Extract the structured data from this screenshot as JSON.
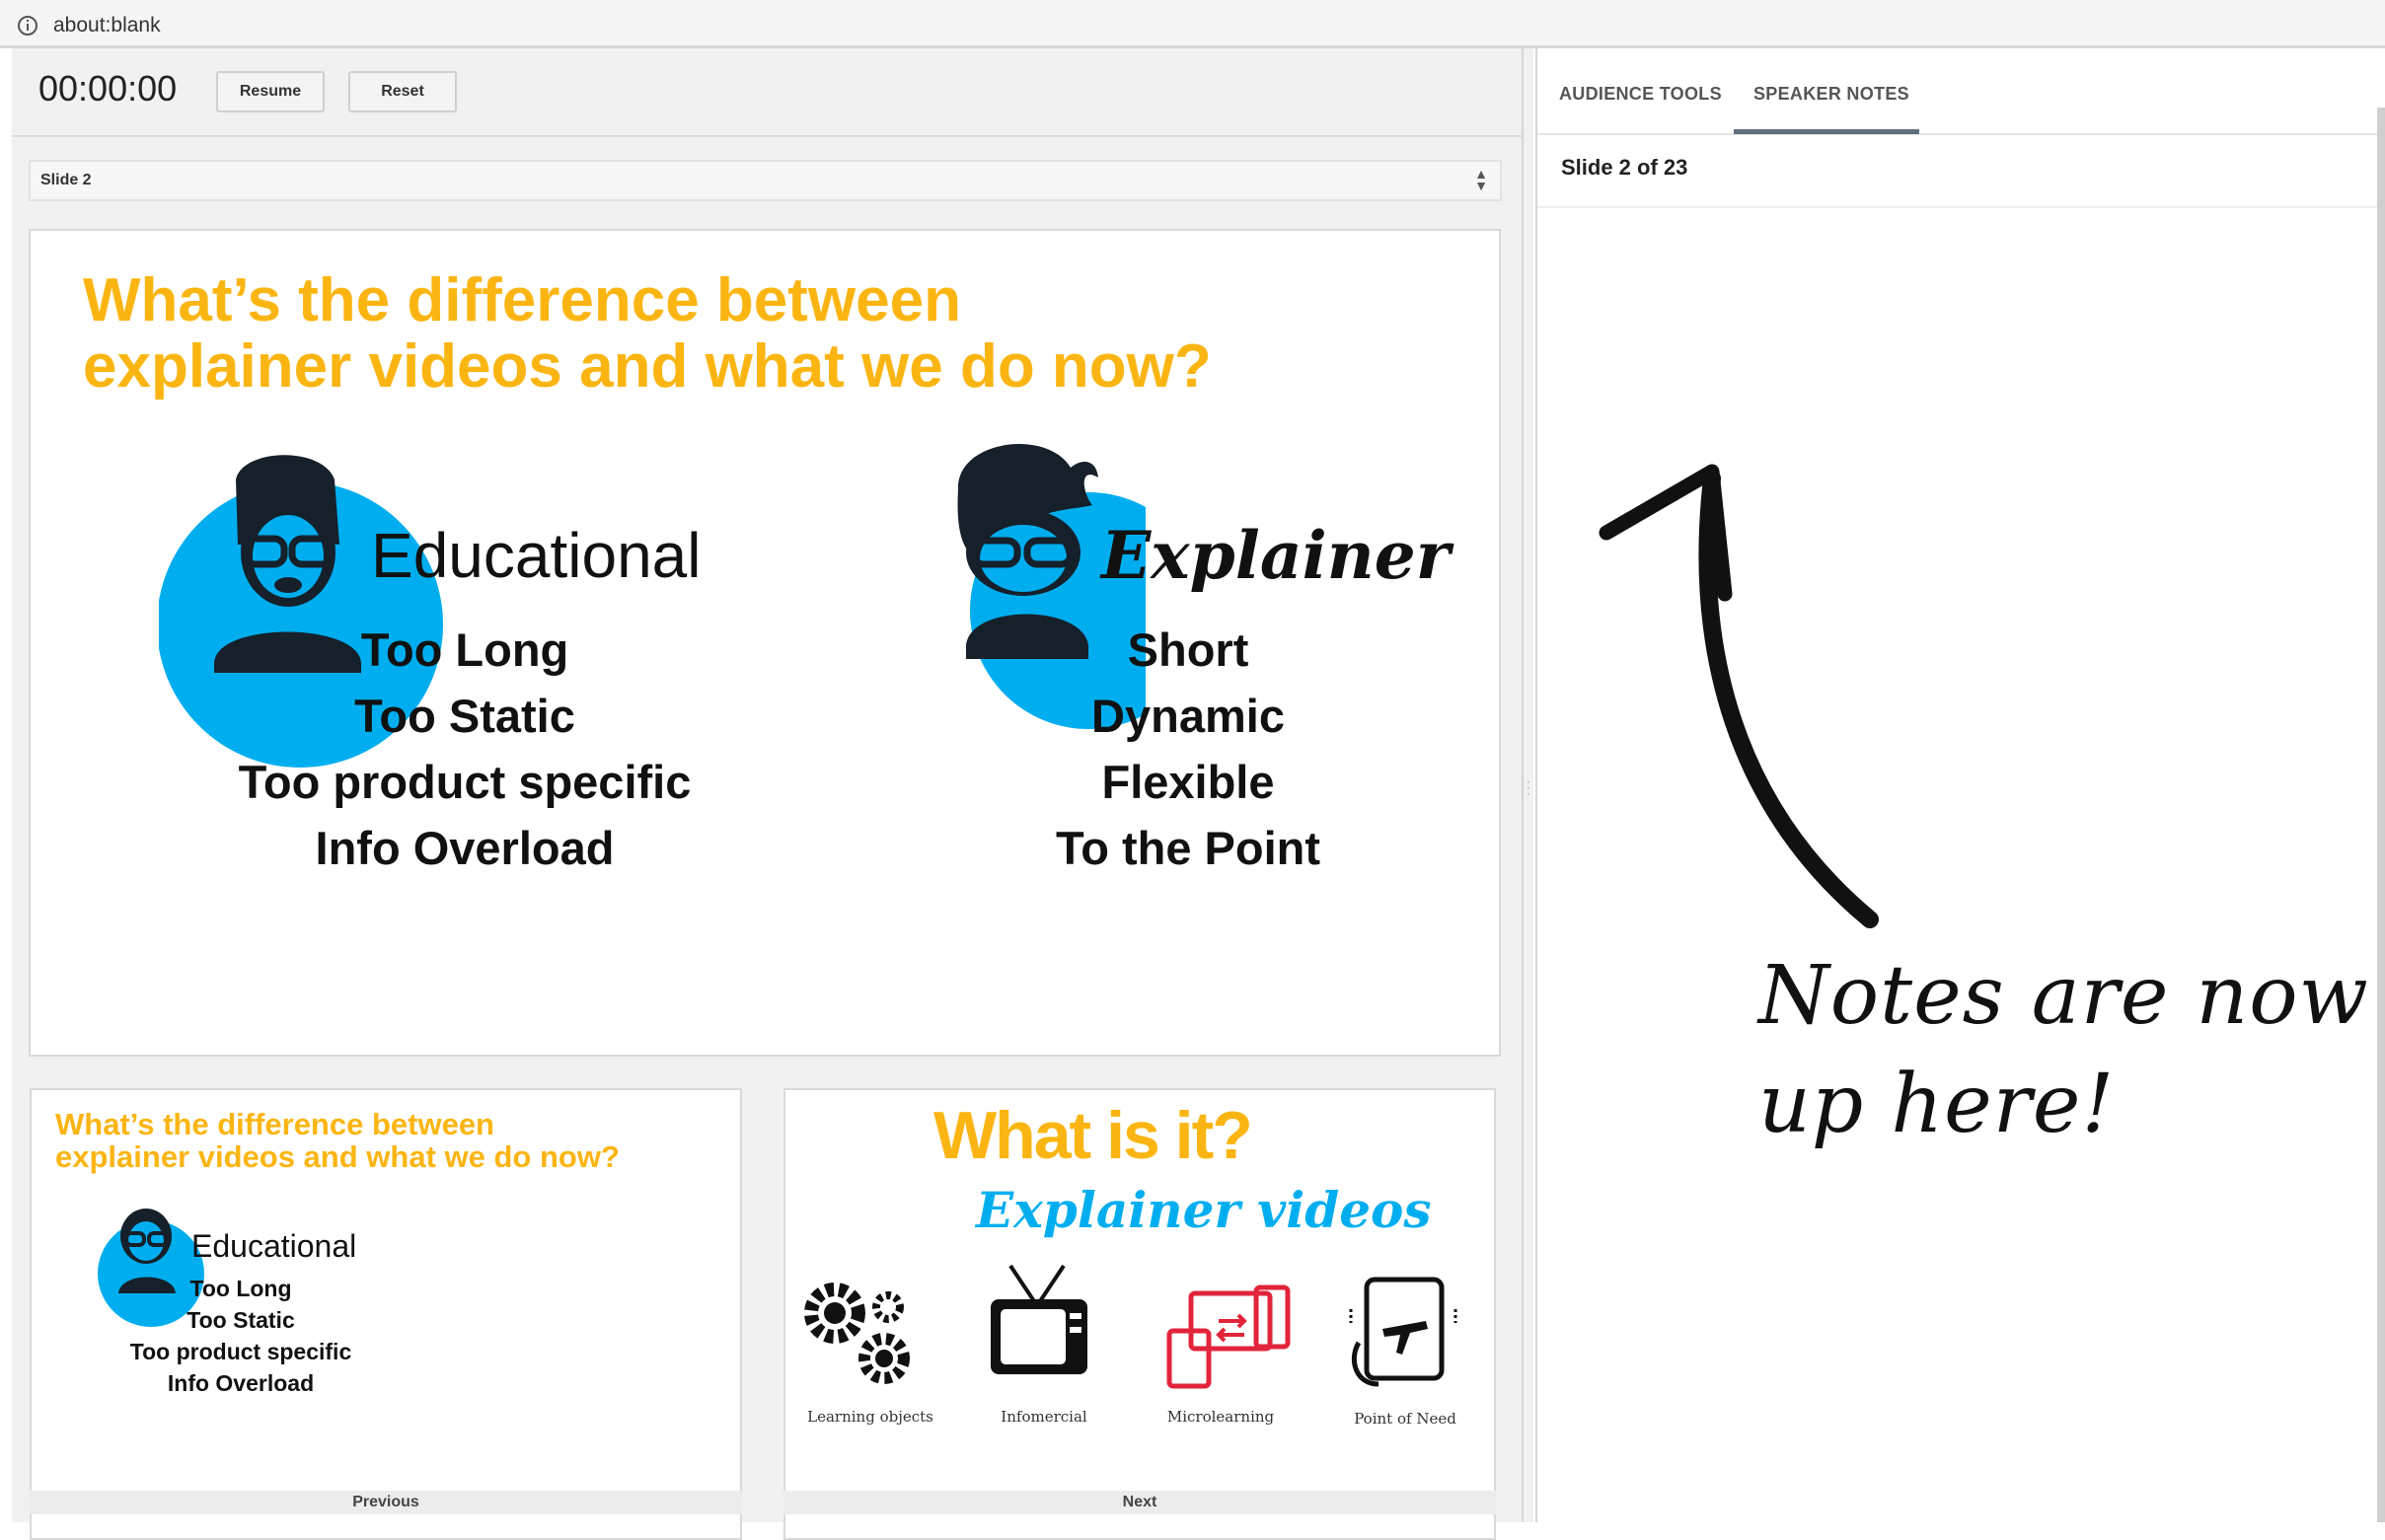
{
  "browser": {
    "url": "about:blank"
  },
  "controls": {
    "timer": "00:00:00",
    "resume_label": "Resume",
    "reset_label": "Reset"
  },
  "slide_select": {
    "value": "Slide 2"
  },
  "main_slide": {
    "title": "What’s the difference between\nexplainer videos and what we do now?",
    "left_heading": "Educational",
    "left_items": [
      "Too Long",
      "Too Static",
      "Too product specific",
      "Info Overload"
    ],
    "right_heading": "Explainer",
    "right_items": [
      "Short",
      "Dynamic",
      "Flexible",
      "To the Point"
    ]
  },
  "previous_slide": {
    "title": "What’s the difference between\nexplainer videos and what we do now?",
    "heading": "Educational",
    "items": [
      "Too Long",
      "Too Static",
      "Too product specific",
      "Info Overload"
    ],
    "caption": "Previous"
  },
  "next_slide": {
    "title": "What is it?",
    "subtitle": "Explainer videos",
    "items": [
      {
        "label": "Learning objects",
        "icon": "gears-icon"
      },
      {
        "label": "Infomercial",
        "icon": "tv-icon"
      },
      {
        "label": "Microlearning",
        "icon": "devices-icon"
      },
      {
        "label": "Point of Need",
        "icon": "tablet-plane-icon"
      }
    ],
    "caption": "Next"
  },
  "right_pane": {
    "tabs": [
      {
        "label": "AUDIENCE TOOLS"
      },
      {
        "label": "SPEAKER NOTES"
      }
    ],
    "slide_counter": "Slide 2 of 23"
  },
  "annotation": {
    "text": "Notes are now\nup here!"
  },
  "colors": {
    "title": "#fbb512",
    "circle": "#00aeef",
    "accent_red": "#e2243b",
    "tab_underline": "#5f6f7e"
  }
}
